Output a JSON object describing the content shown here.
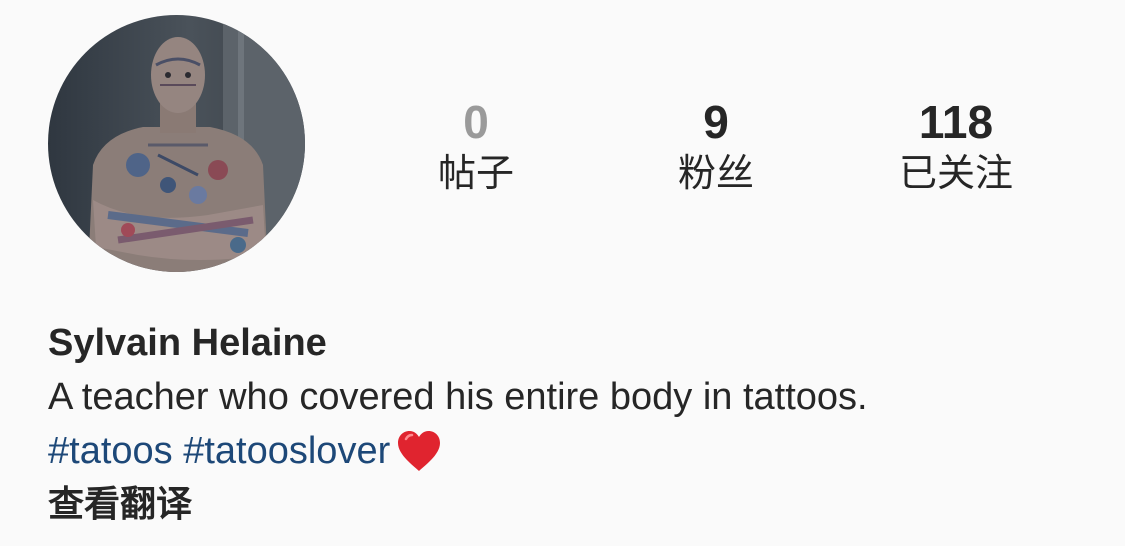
{
  "profile": {
    "avatar": {
      "icon": "profile-photo",
      "alt": ""
    },
    "stats": {
      "posts": {
        "count": "0",
        "label": "帖子"
      },
      "followers": {
        "count": "9",
        "label": "粉丝"
      },
      "following": {
        "count": "118",
        "label": "已关注"
      }
    },
    "name": "Sylvain Helaine",
    "bio": "A teacher who covered his entire body in tattoos.",
    "hashtags": [
      "#tatoos",
      "#tatooslover"
    ],
    "emoji": "heart-emoji",
    "translate_label": "查看翻译"
  },
  "colors": {
    "background": "#fafafa",
    "text": "#262626",
    "muted_count": "#9a9a9a",
    "hashtag": "#1d4878",
    "heart": "#e0242f"
  }
}
